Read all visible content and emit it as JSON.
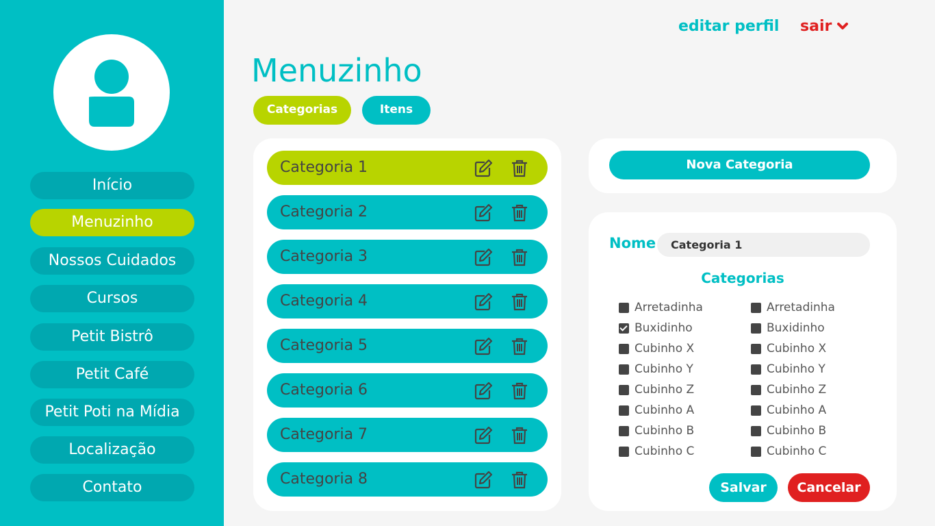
{
  "header": {
    "edit_profile": "editar perfil",
    "logout": "sair"
  },
  "sidebar": {
    "items": [
      {
        "label": "Início"
      },
      {
        "label": "Menuzinho",
        "active": true
      },
      {
        "label": "Nossos Cuidados"
      },
      {
        "label": "Cursos"
      },
      {
        "label": "Petit Bistrô"
      },
      {
        "label": "Petit Café"
      },
      {
        "label": "Petit Poti na Mídia"
      },
      {
        "label": "Localização"
      },
      {
        "label": "Contato"
      }
    ]
  },
  "main": {
    "title": "Menuzinho",
    "tabs": [
      {
        "label": "Categorias",
        "active": true
      },
      {
        "label": "Itens"
      }
    ],
    "categories": [
      {
        "label": "Categoria 1",
        "active": true
      },
      {
        "label": "Categoria 2"
      },
      {
        "label": "Categoria 3"
      },
      {
        "label": "Categoria 4"
      },
      {
        "label": "Categoria 5"
      },
      {
        "label": "Categoria 6"
      },
      {
        "label": "Categoria 7"
      },
      {
        "label": "Categoria 8"
      }
    ]
  },
  "form": {
    "new_button": "Nova Categoria",
    "name_label": "Nome",
    "name_value": "Categoria 1",
    "categories_title": "Categorias",
    "checklist_left": [
      {
        "label": "Arretadinha",
        "checked": false
      },
      {
        "label": "Buxidinho",
        "checked": true
      },
      {
        "label": "Cubinho X",
        "checked": false
      },
      {
        "label": "Cubinho Y",
        "checked": false
      },
      {
        "label": "Cubinho Z",
        "checked": false
      },
      {
        "label": "Cubinho A",
        "checked": false
      },
      {
        "label": "Cubinho B",
        "checked": false
      },
      {
        "label": "Cubinho C",
        "checked": false
      }
    ],
    "checklist_right": [
      {
        "label": "Arretadinha",
        "checked": false
      },
      {
        "label": "Buxidinho",
        "checked": false
      },
      {
        "label": "Cubinho X",
        "checked": false
      },
      {
        "label": "Cubinho Y",
        "checked": false
      },
      {
        "label": "Cubinho Z",
        "checked": false
      },
      {
        "label": "Cubinho A",
        "checked": false
      },
      {
        "label": "Cubinho B",
        "checked": false
      },
      {
        "label": "Cubinho C",
        "checked": false
      }
    ],
    "save_label": "Salvar",
    "cancel_label": "Cancelar"
  },
  "colors": {
    "primary": "#00bfc4",
    "accent": "#b8d400",
    "danger": "#e02020"
  }
}
